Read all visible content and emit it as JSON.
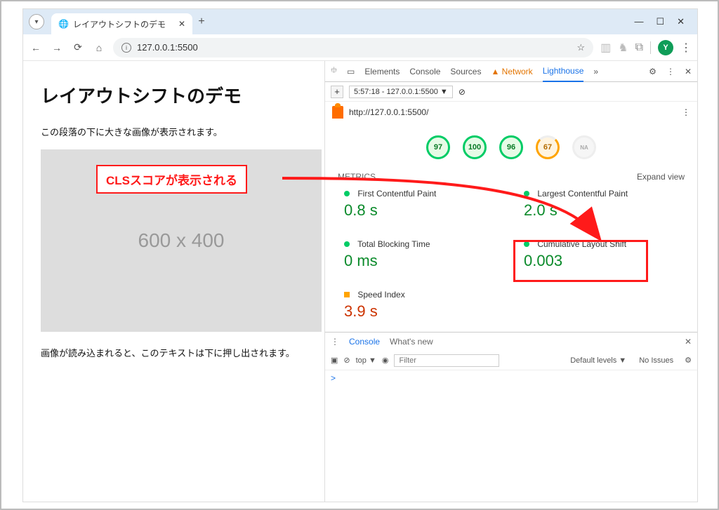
{
  "browser": {
    "tab_title": "レイアウトシフトのデモ",
    "url": "127.0.0.1:5500",
    "avatar_letter": "Y"
  },
  "page": {
    "heading": "レイアウトシフトのデモ",
    "para1": "この段落の下に大きな画像が表示されます。",
    "placeholder": "600 x 400",
    "para2": "画像が読み込まれると、このテキストは下に押し出されます。"
  },
  "devtools": {
    "tabs": {
      "elements": "Elements",
      "console": "Console",
      "sources": "Sources",
      "network": "Network",
      "lighthouse": "Lighthouse",
      "more": "»"
    },
    "timebox": "5:57:18 - 127.0.0.1:5500 ▼",
    "report_url": "http://127.0.0.1:5500/",
    "gauges": {
      "g1": "97",
      "g2": "100",
      "g3": "96",
      "g4": "67",
      "g5": "NA"
    },
    "metrics_title": "METRICS",
    "expand": "Expand view",
    "metrics": {
      "fcp": {
        "label": "First Contentful Paint",
        "value": "0.8 s"
      },
      "lcp": {
        "label": "Largest Contentful Paint",
        "value": "2.0 s"
      },
      "tbt": {
        "label": "Total Blocking Time",
        "value": "0 ms"
      },
      "cls": {
        "label": "Cumulative Layout Shift",
        "value": "0.003"
      },
      "si": {
        "label": "Speed Index",
        "value": "3.9 s"
      }
    },
    "drawer": {
      "console": "Console",
      "whatsnew": "What's new",
      "top": "top ▼",
      "filter_ph": "Filter",
      "levels": "Default levels ▼",
      "noissues": "No Issues",
      "prompt": ">"
    }
  },
  "annotation": {
    "label": "CLSスコアが表示される"
  }
}
